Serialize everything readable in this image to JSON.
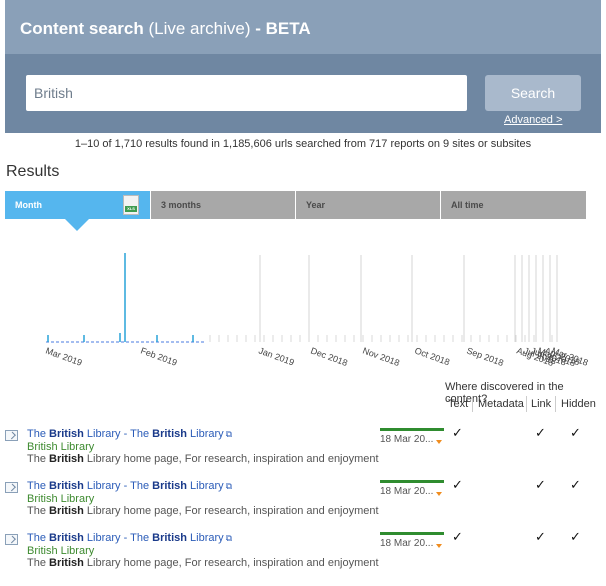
{
  "header": {
    "title_main": "Content search",
    "title_sub": "(Live archive)",
    "title_tail": "- BETA",
    "search_value": "British",
    "search_button": "Search",
    "advanced_link": "Advanced >"
  },
  "summary": "1–10 of 1,710 results found in 1,185,606 urls searched from 717 reports on 9 sites or subsites",
  "results_heading": "Results",
  "tabs": [
    {
      "label": "Month",
      "active": true
    },
    {
      "label": "3 months",
      "active": false
    },
    {
      "label": "Year",
      "active": false
    },
    {
      "label": "All time",
      "active": false
    }
  ],
  "export_icon": {
    "name": "xls-icon",
    "label": "XLS"
  },
  "chart_data": {
    "type": "bar",
    "x_tick_labels": [
      "Mar 2019",
      "Feb 2019",
      "Jan 2019",
      "Dec 2018",
      "Nov 2018",
      "Oct 2018",
      "Sep 2018",
      "Aug 2018",
      "Jul 2018",
      "Jun 2018",
      "May 2018",
      "Apr 2018",
      "Mar 2018"
    ],
    "note": "Timeline of result counts; highlighted month is blue, older months grey"
  },
  "table": {
    "discovered_label": "Where discovered in the content?",
    "columns": [
      "Text",
      "Metadata",
      "Link",
      "Hidden"
    ],
    "rows": [
      {
        "title_parts": [
          "The ",
          "British",
          " Library - The ",
          "British",
          " Library"
        ],
        "site": "British Library",
        "desc_parts": [
          "The ",
          "British",
          " Library home page, For research, inspiration and enjoyment"
        ],
        "date": "18 Mar 20...",
        "text": true,
        "metadata": false,
        "link": true,
        "hidden": true
      },
      {
        "title_parts": [
          "The ",
          "British",
          " Library - The ",
          "British",
          " Library"
        ],
        "site": "British Library",
        "desc_parts": [
          "The ",
          "British",
          " Library home page, For research, inspiration and enjoyment"
        ],
        "date": "18 Mar 20...",
        "text": true,
        "metadata": false,
        "link": true,
        "hidden": true
      },
      {
        "title_parts": [
          "The ",
          "British",
          " Library - The ",
          "British",
          " Library"
        ],
        "site": "British Library",
        "desc_parts": [
          "The ",
          "British",
          " Library home page, For research, inspiration and enjoyment"
        ],
        "date": "18 Mar 20...",
        "text": true,
        "metadata": false,
        "link": true,
        "hidden": true
      }
    ],
    "check_glyph": "✓",
    "external_icon": "external-link-icon"
  },
  "colors": {
    "active_tab": "#55b6ee",
    "header_dark": "#6f87a2",
    "header_light": "#8aa0b8",
    "link": "#2b5cb8",
    "site": "#3d8a2f",
    "greenbar": "#2f8c2f"
  }
}
